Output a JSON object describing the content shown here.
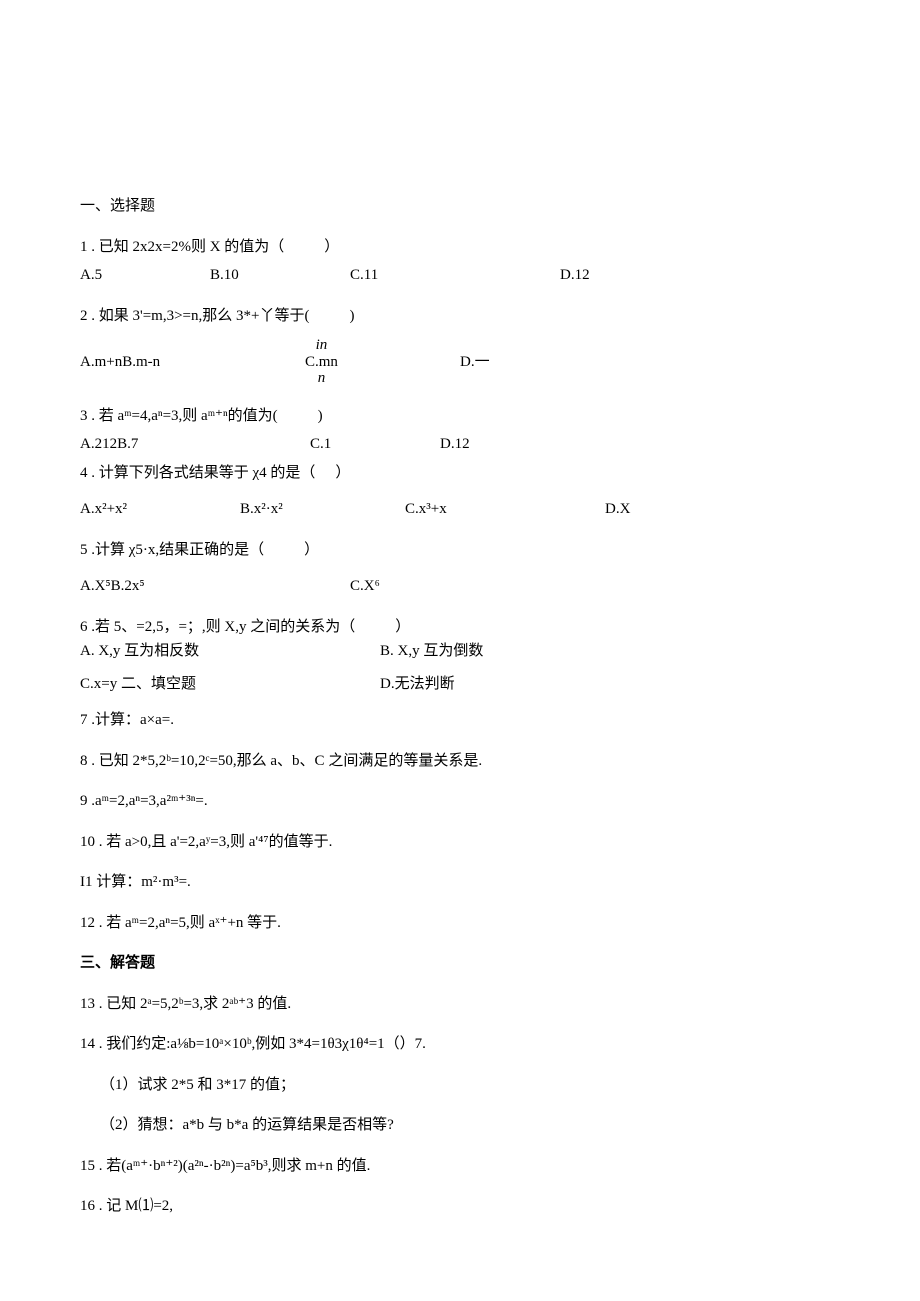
{
  "sections": {
    "s1_title": "一、选择题",
    "s2_title_inline": "二、填空题",
    "s3_title": "三、解答题"
  },
  "q1": {
    "stem_prefix": "1 . 已知 2x2x=2%则 X 的值为（",
    "stem_suffix": "）",
    "optA": "A.5",
    "optB": "B.10",
    "optC": "C.11",
    "optD": "D.12"
  },
  "q2": {
    "stem_prefix": "2 . 如果 3'=m,3>=n,那么 3*+丫等于(",
    "stem_suffix": ")",
    "optA": "A.m+nB.m-n",
    "optC_prefix": "C.",
    "optC_num": "in",
    "optC_den": "n",
    "optC_text": "mn",
    "optD": "D.一"
  },
  "q3": {
    "stem_prefix": "3 . 若 aᵐ=4,aⁿ=3,则 aᵐ⁺ⁿ的值为(",
    "stem_suffix": ")",
    "optA": "A.212B.7",
    "optC": "C.1",
    "optD": "D.12"
  },
  "q4": {
    "stem_prefix": "4 . 计算下列各式结果等于 χ4 的是（",
    "stem_suffix": "）",
    "optA": "A.x²+x²",
    "optB": "B.x²·x²",
    "optC": "C.x³+x",
    "optD": "D.X"
  },
  "q5": {
    "stem_prefix": "5 .计算 χ5·x,结果正确的是（",
    "stem_suffix": "）",
    "optA": "A.X⁵B.2x⁵",
    "optC": "C.X⁶"
  },
  "q6": {
    "stem_prefix": "6 .若 5、=2,5，=；,则 X,y 之间的关系为（",
    "stem_suffix": "）",
    "optA": "A. X,y 互为相反数",
    "optB": "B. X,y 互为倒数",
    "optC": "C.x=y ",
    "optD": "D.无法判断"
  },
  "q7": "7 .计算：a×a=.",
  "q8": "8 . 已知 2*5,2ᵇ=10,2ᶜ=50,那么 a、b、C 之间满足的等量关系是.",
  "q9": "9 .aᵐ=2,aⁿ=3,a²ᵐ⁺³ⁿ=.",
  "q10": "10 . 若 a>0,且 a'=2,aʸ=3,则 a'⁴⁷的值等于.",
  "q11": "I1 计算：m²·m³=.",
  "q12": "12 . 若 aᵐ=2,aⁿ=5,则 aˣ⁺+n 等于.",
  "q13": "13 . 已知 2ᵃ=5,2ᵇ=3,求 2ᵃᵇ⁺3 的值.",
  "q14": {
    "stem": "14 . 我们约定:a⅛b=10ᵃ×10ᵇ,例如 3*4=1θ3χ1θ⁴=1（）7.",
    "sub1": "（1）试求 2*5 和 3*17 的值；",
    "sub2": "（2）猜想：a*b 与 b*a 的运算结果是否相等?"
  },
  "q15": "15 . 若(aᵐ⁺·bⁿ⁺²)(a²ⁿ-·b²ⁿ)=a⁵b³,则求 m+n 的值.",
  "q16": "16 . 记 M⑴=2,"
}
